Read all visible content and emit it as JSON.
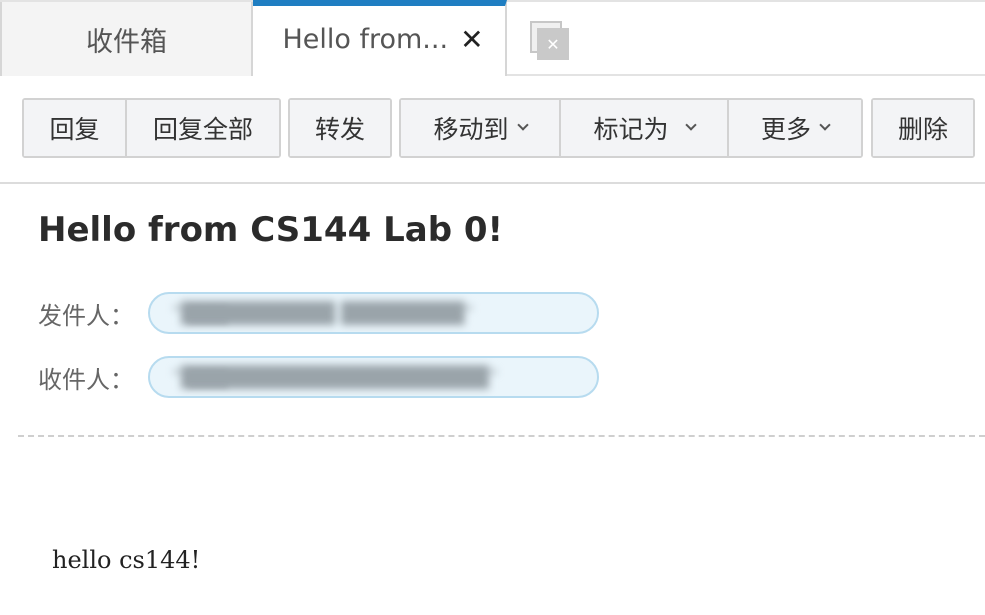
{
  "tabs": [
    {
      "label": "收件箱"
    },
    {
      "label": "Hello from...",
      "close_glyph": "✕"
    }
  ],
  "tab_restore_glyph": "✕",
  "toolbar": {
    "reply": "回复",
    "reply_all": "回复全部",
    "forward": "转发",
    "move_to": "移动到",
    "mark_as": "标记为",
    "more": "更多",
    "delete": "删除"
  },
  "mail": {
    "subject": "Hello from CS144 Lab 0!",
    "from_label": "发件人：",
    "from_value": "\"██████████ ████████\"",
    "to_label": "收件人：",
    "to_value": "\"████████████████████\"",
    "body": "hello cs144!"
  },
  "colors": {
    "active_tab_accent": "#1f7ec2",
    "address_pill_border": "#b7dbef",
    "address_pill_bg": "#eaf5fb"
  }
}
